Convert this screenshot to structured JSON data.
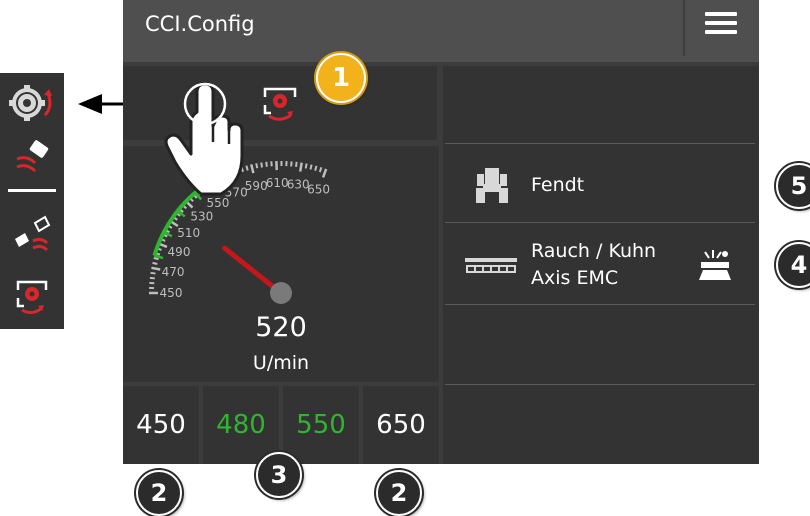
{
  "app_title": "CCI.Config",
  "icons": {
    "menu": "hamburger-menu-icon",
    "sidebar": [
      "gear-rotate-icon",
      "spreader-disc-icon",
      "boundary-spreading-icon",
      "rpm-config-icon"
    ],
    "rpm_button": "rpm-config-icon",
    "tractor": "tractor-icon",
    "implement": "spreader-implement-icon",
    "implement_status": "spreading-status-icon"
  },
  "gauge": {
    "ticks": [
      "450",
      "470",
      "490",
      "510",
      "530",
      "550",
      "570",
      "590",
      "610",
      "630",
      "650"
    ],
    "min": 450,
    "max": 650,
    "green_min": 480,
    "green_max": 550,
    "needle_value": 520,
    "value": "520",
    "unit": "U/min"
  },
  "preset_buttons": [
    "450",
    "480",
    "550",
    "650"
  ],
  "tractor": {
    "name": "Fendt"
  },
  "implement": {
    "line1": "Rauch / Kuhn",
    "line2": "Axis EMC"
  },
  "callouts": {
    "c1": "1",
    "c2a": "2",
    "c2b": "2",
    "c3": "3",
    "c4": "4",
    "c5": "5"
  },
  "colors": {
    "background": "#3c3c3c",
    "panel": "#333333",
    "header": "#4f4f4f",
    "accent_green": "#2fb52f",
    "needle_red": "#c4161c",
    "callout_yellow": "#f2b21c"
  }
}
